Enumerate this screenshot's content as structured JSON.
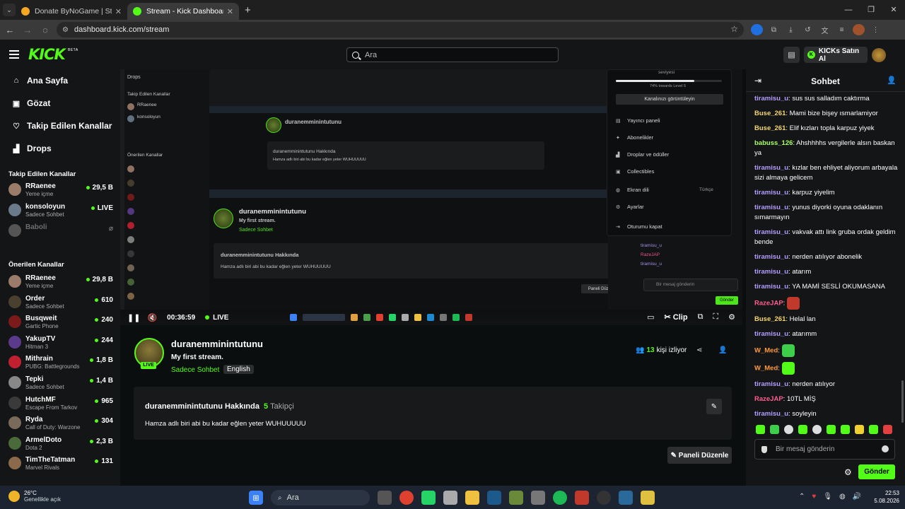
{
  "browser": {
    "tabs": [
      {
        "title": "Donate ByNoGame | Streamer S",
        "active": false,
        "favicon_color": "#f5a623"
      },
      {
        "title": "Stream - Kick Dashboard",
        "active": true,
        "favicon_color": "#53fc18"
      }
    ],
    "url": "dashboard.kick.com/stream"
  },
  "header": {
    "logo": "KICK",
    "beta": "BETA",
    "search_placeholder": "Ara",
    "kicks_button": "KICKs Satın Al"
  },
  "sidebar": {
    "nav": [
      {
        "label": "Ana Sayfa",
        "icon": "home-icon"
      },
      {
        "label": "Gözat",
        "icon": "browse-icon"
      },
      {
        "label": "Takip Edilen Kanallar",
        "icon": "heart-icon"
      },
      {
        "label": "Drops",
        "icon": "drops-icon"
      }
    ],
    "followed_title": "Takip Edilen Kanallar",
    "followed": [
      {
        "name": "RRaenee",
        "category": "Yeme içme",
        "viewers": "29,5 B",
        "color": "#9b7b6a"
      },
      {
        "name": "konsoloyun",
        "category": "Sadece Sohbet",
        "viewers": "LIVE",
        "color": "#6a7a8a"
      },
      {
        "name": "Baboli",
        "category": "",
        "viewers": "",
        "color": "#555"
      }
    ],
    "recommended_title": "Önerilen Kanallar",
    "recommended": [
      {
        "name": "RRaenee",
        "category": "Yeme içme",
        "viewers": "29,8 B",
        "color": "#9b7b6a"
      },
      {
        "name": "Order",
        "category": "Sadece Sohbet",
        "viewers": "610",
        "color": "#4a4030"
      },
      {
        "name": "Busqweit",
        "category": "Gartic Phone",
        "viewers": "240",
        "color": "#7a1a1a"
      },
      {
        "name": "YakupTV",
        "category": "Hitman 3",
        "viewers": "244",
        "color": "#5a3a8a"
      },
      {
        "name": "Mithrain",
        "category": "PUBG: Battlegrounds",
        "viewers": "1,8 B",
        "color": "#c02030"
      },
      {
        "name": "Tepki",
        "category": "Sadece Sohbet",
        "viewers": "1,4 B",
        "color": "#888"
      },
      {
        "name": "HutchMF",
        "category": "Escape From Tarkov",
        "viewers": "965",
        "color": "#3a3a3a"
      },
      {
        "name": "Ryda",
        "category": "Call of Duty: Warzone",
        "viewers": "304",
        "color": "#7a6a5a"
      },
      {
        "name": "ArmelDoto",
        "category": "Dota 2",
        "viewers": "2,3 B",
        "color": "#4a6a3a"
      },
      {
        "name": "TimTheTatman",
        "category": "Marvel Rivals",
        "viewers": "131",
        "color": "#8a6a4a"
      }
    ]
  },
  "player": {
    "time": "00:36:59",
    "live": "LIVE",
    "clip": "Clip",
    "ghost_menu": {
      "level_top": "seviyesi",
      "level_text": "74% towards Level 5",
      "view_channel": "Kanalınızı görüntüleyin",
      "items": [
        "Yayıncı paneli",
        "Abonelikler",
        "Droplar ve ödüller",
        "Collectibles",
        "Ekran dili",
        "Ayarlar",
        "Oturumu kapat"
      ],
      "lang_value": "Türkçe"
    }
  },
  "channel": {
    "name": "duranemminintutunu",
    "live_badge": "LIVE",
    "stream_title": "My first stream.",
    "category": "Sadece Sohbet",
    "language": "English",
    "viewers_count": "13",
    "viewers_label": "kişi izliyor",
    "about_title": "duranemminintutunu Hakkında",
    "followers_count": "5",
    "followers_label": "Takipçi",
    "about_text": "Hamza adlı biri abi bu kadar eğlen yeter WUHUUUUU",
    "edit_panel": "Paneli Düzenle"
  },
  "chat": {
    "title": "Sohbet",
    "messages": [
      {
        "user": "tiramisu_u",
        "color": "#b39dff",
        "text": "sus sus salladım caktırma"
      },
      {
        "user": "Buse_261",
        "color": "#f5d76e",
        "text": "Mami bize bişey ısmarlamiyor"
      },
      {
        "user": "Buse_261",
        "color": "#f5d76e",
        "text": "Elif kızları topla karpuz yiyek"
      },
      {
        "user": "babuss_126",
        "color": "#a8ff60",
        "text": "Ahshhhhs vergilerle alsın baskan ya"
      },
      {
        "user": "tiramisu_u",
        "color": "#b39dff",
        "text": "kızlar ben ehliyet aliyorum arbayala sizi almaya gelicem"
      },
      {
        "user": "tiramisu_u",
        "color": "#b39dff",
        "text": "karpuz yiyelim"
      },
      {
        "user": "tiramisu_u",
        "color": "#b39dff",
        "text": "yunus diyorki oyuna odaklanın sımarmayın"
      },
      {
        "user": "tiramisu_u",
        "color": "#b39dff",
        "text": "vakvak attı link gruba ordak geldim bende"
      },
      {
        "user": "tiramisu_u",
        "color": "#b39dff",
        "text": "nerden atılıyor abonelik"
      },
      {
        "user": "tiramisu_u",
        "color": "#b39dff",
        "text": "atarım"
      },
      {
        "user": "tiramisu_u",
        "color": "#b39dff",
        "text": "YA MAMİ SESLİ OKUMASANA"
      },
      {
        "user": "RazeJAP",
        "color": "#ff5d8f",
        "text": "",
        "emote_color": "#c0392b"
      },
      {
        "user": "Buse_261",
        "color": "#f5d76e",
        "text": "Helal lan"
      },
      {
        "user": "tiramisu_u",
        "color": "#b39dff",
        "text": "atarımm"
      },
      {
        "user": "W_Med",
        "color": "#ff9a3c",
        "text": "",
        "emote_color": "#3ecf4a"
      },
      {
        "user": "W_Med",
        "color": "#ff9a3c",
        "text": "",
        "emote_color": "#53fc18"
      },
      {
        "user": "tiramisu_u",
        "color": "#b39dff",
        "text": "nerden atılıyor"
      },
      {
        "user": "RazeJAP",
        "color": "#ff5d8f",
        "text": "10TL MİŞ"
      },
      {
        "user": "tiramisu_u",
        "color": "#b39dff",
        "text": "soyleyin"
      }
    ],
    "input_placeholder": "Bir mesaj gönderin",
    "send": "Gönder"
  },
  "taskbar": {
    "temp": "26°C",
    "weather": "Genellikle açık",
    "search": "Ara",
    "time": "22:53",
    "date": "5.08.2026"
  }
}
